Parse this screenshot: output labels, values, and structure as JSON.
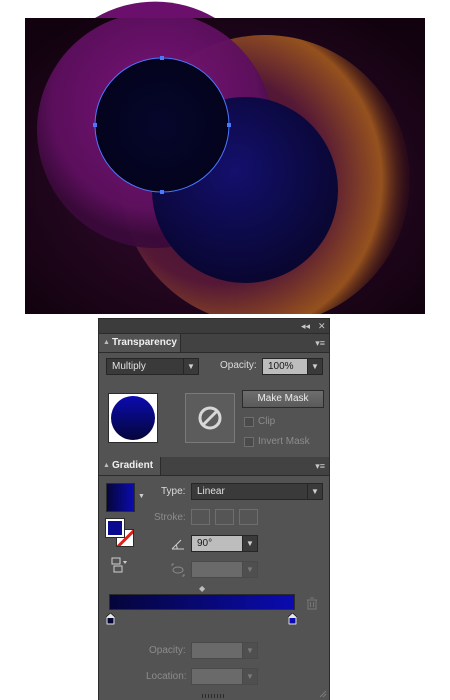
{
  "artwork": {
    "background": "#1a0418",
    "circles": [
      {
        "name": "magenta-circle",
        "color": "#8a1a8c"
      },
      {
        "name": "orange-glow-circle",
        "color": "#d2841b"
      },
      {
        "name": "blue-circle",
        "color": "#0e0e70"
      },
      {
        "name": "selected-circle",
        "color": "#05052a"
      }
    ],
    "selection_color": "#4a78ff"
  },
  "panel_header": {
    "collapse_icon": "double-chevron-left-icon",
    "close_icon": "close-icon",
    "collapse_glyph": "◂◂",
    "close_glyph": "✕"
  },
  "transparency": {
    "tab_label": "Transparency",
    "blend_mode": "Multiply",
    "opacity_label": "Opacity:",
    "opacity_value": "100%",
    "make_mask_label": "Make Mask",
    "clip_label": "Clip",
    "invert_mask_label": "Invert Mask",
    "menu_glyph": "▾≡"
  },
  "gradient": {
    "tab_label": "Gradient",
    "type_label": "Type:",
    "type_value": "Linear",
    "stroke_label": "Stroke:",
    "angle_value": "90°",
    "aspect_value": "",
    "opacity_label": "Opacity:",
    "opacity_value": "",
    "location_label": "Location:",
    "location_value": "",
    "colors": {
      "start": "#05053a",
      "end": "#0b0bb0",
      "fill_swatch": "#0a0a90"
    },
    "menu_glyph": "▾≡"
  }
}
